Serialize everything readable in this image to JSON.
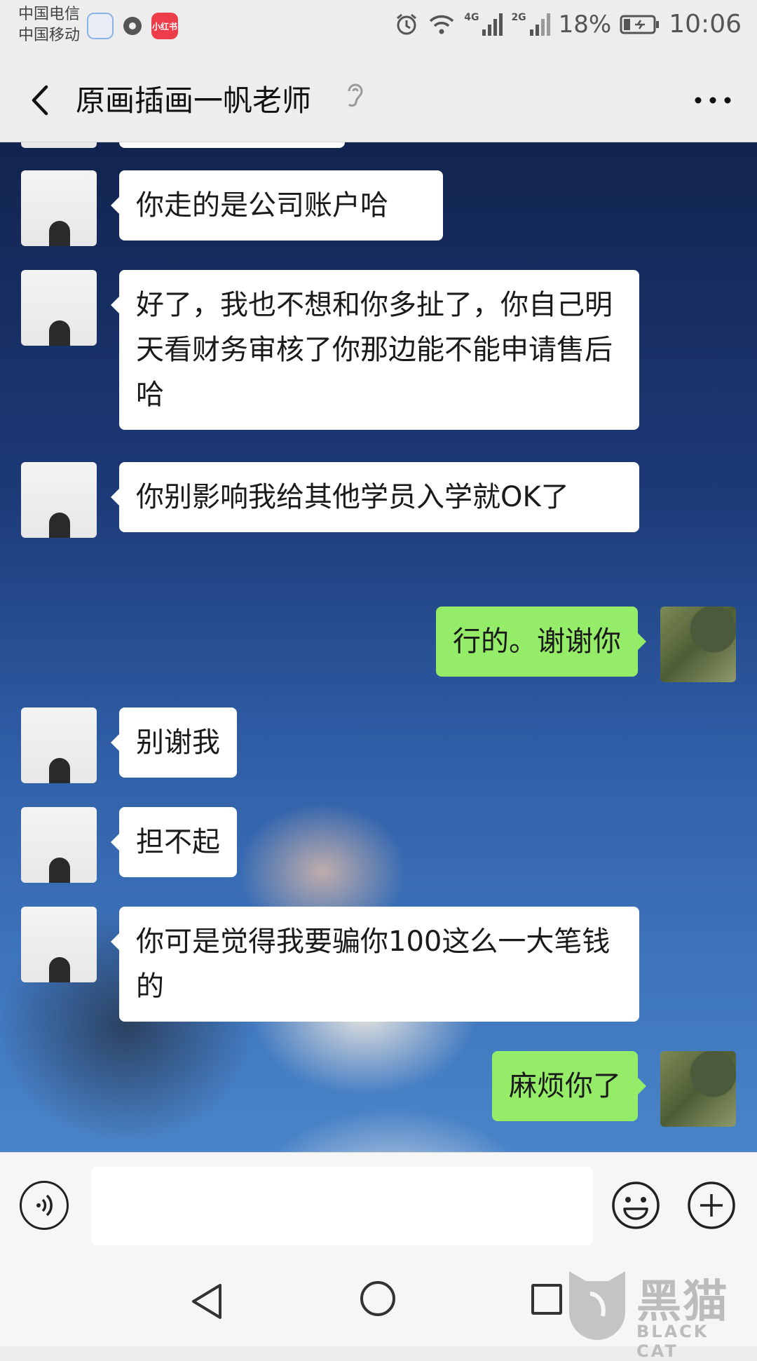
{
  "status_bar": {
    "carrier_1": "中国电信",
    "carrier_2": "中国移动",
    "app_icon_3_label": "小红书",
    "network_1": "4G",
    "network_2": "2G",
    "battery": "18%",
    "time": "10:06"
  },
  "header": {
    "title": "原画插画一帆老师"
  },
  "messages": [
    {
      "side": "left",
      "text": "你走的是公司账户哈"
    },
    {
      "side": "left",
      "text": "好了，我也不想和你多扯了，你自己明天看财务审核了你那边能不能申请售后哈"
    },
    {
      "side": "left",
      "text": "你别影响我给其他学员入学就OK了"
    },
    {
      "side": "right",
      "text": "行的。谢谢你"
    },
    {
      "side": "left",
      "text": "别谢我"
    },
    {
      "side": "left",
      "text": "担不起"
    },
    {
      "side": "left",
      "text": "你可是觉得我要骗你100这么一大笔钱的"
    },
    {
      "side": "right",
      "text": "麻烦你了"
    }
  ],
  "input_bar": {
    "text_value": ""
  },
  "watermark": {
    "text": "黑猫",
    "sub": "BLACK CAT"
  },
  "colors": {
    "my_bubble": "#95ec69",
    "their_bubble": "#ffffff",
    "chrome": "#ededed"
  },
  "icons": [
    "voice-icon",
    "emoji-icon",
    "plus-icon",
    "back-arrow-icon",
    "more-icon",
    "ear-icon"
  ]
}
